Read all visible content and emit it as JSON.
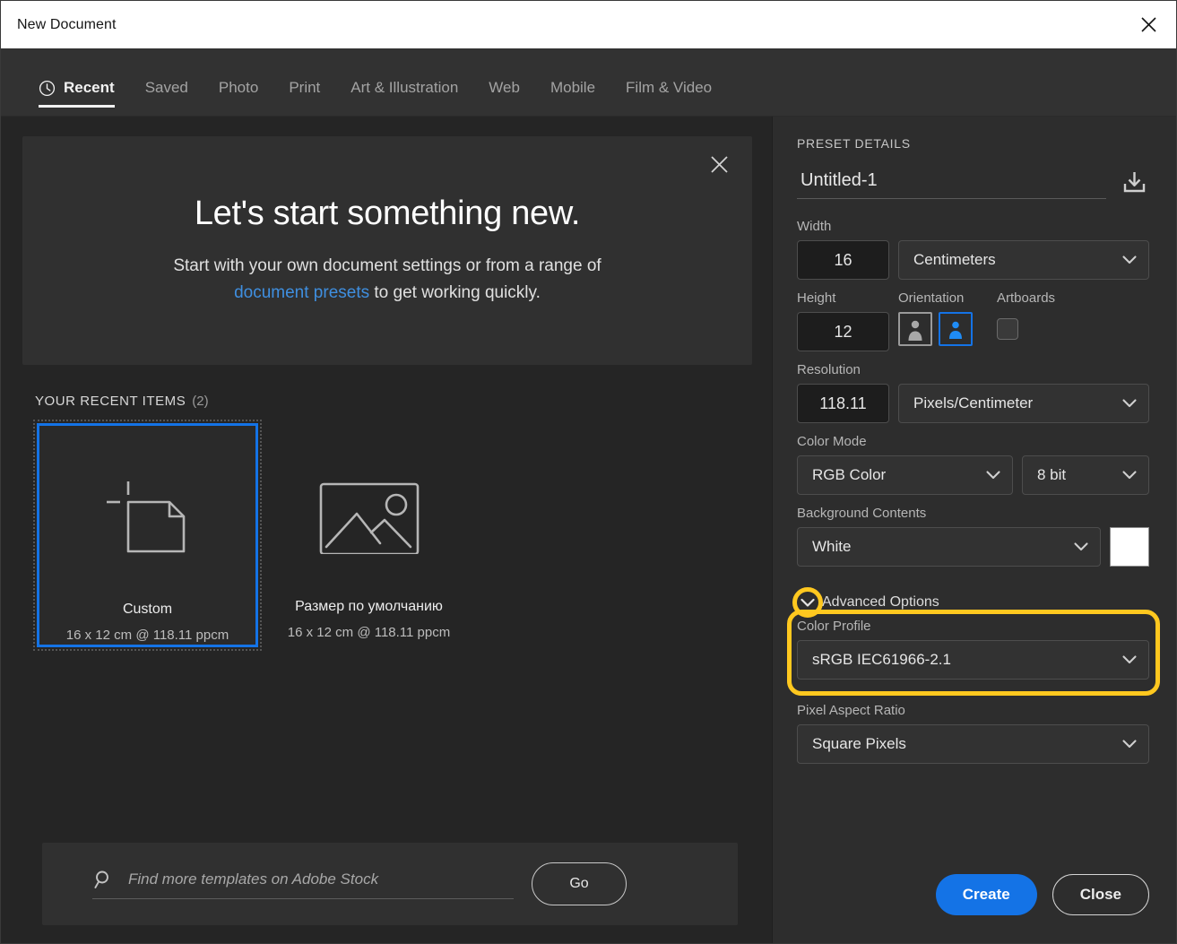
{
  "window": {
    "title": "New Document",
    "close_icon": "close-icon"
  },
  "tabs": [
    {
      "label": "Recent",
      "icon": "clock-icon",
      "active": true
    },
    {
      "label": "Saved",
      "active": false
    },
    {
      "label": "Photo",
      "active": false
    },
    {
      "label": "Print",
      "active": false
    },
    {
      "label": "Art & Illustration",
      "active": false
    },
    {
      "label": "Web",
      "active": false
    },
    {
      "label": "Mobile",
      "active": false
    },
    {
      "label": "Film & Video",
      "active": false
    }
  ],
  "promo": {
    "title": "Let's start something new.",
    "subtitle_part1": "Start with your own document settings or from a range of",
    "link_text": "document presets",
    "subtitle_part2": "to get working quickly.",
    "close_icon": "close-icon"
  },
  "recent": {
    "heading": "YOUR RECENT ITEMS",
    "count": "(2)",
    "items": [
      {
        "name": "Custom",
        "meta": "16 x 12 cm @ 118.11 ppcm",
        "icon": "custom-document-icon",
        "selected": true
      },
      {
        "name": "Размер по умолчанию",
        "meta": "16 x 12 cm @ 118.11 ppcm",
        "icon": "image-placeholder-icon",
        "selected": false
      }
    ]
  },
  "stock": {
    "search_placeholder": "Find more templates on Adobe Stock",
    "search_value": "",
    "search_icon": "search-icon",
    "go_label": "Go"
  },
  "preset_details": {
    "heading": "PRESET DETAILS",
    "name_value": "Untitled-1",
    "save_preset_icon": "save-preset-icon",
    "width": {
      "label": "Width",
      "value": "16",
      "unit": "Centimeters"
    },
    "height": {
      "label": "Height",
      "value": "12"
    },
    "orientation": {
      "label": "Orientation",
      "portrait_icon": "portrait-orientation-icon",
      "landscape_icon": "landscape-orientation-icon",
      "selected": "landscape"
    },
    "artboards": {
      "label": "Artboards",
      "checked": false
    },
    "resolution": {
      "label": "Resolution",
      "value": "118.11",
      "unit": "Pixels/Centimeter"
    },
    "color_mode": {
      "label": "Color Mode",
      "value": "RGB Color",
      "depth": "8 bit"
    },
    "background_contents": {
      "label": "Background Contents",
      "value": "White",
      "swatch_color": "#ffffff"
    },
    "advanced_options": {
      "label": "Advanced Options",
      "expanded": true,
      "color_profile": {
        "label": "Color Profile",
        "value": "sRGB IEC61966-2.1"
      },
      "pixel_aspect_ratio": {
        "label": "Pixel Aspect Ratio",
        "value": "Square Pixels"
      }
    }
  },
  "footer": {
    "create_label": "Create",
    "close_label": "Close"
  },
  "colors": {
    "accent_blue": "#1473e6",
    "highlight_yellow": "#ffc81f",
    "link_blue": "#3f8fe0"
  }
}
